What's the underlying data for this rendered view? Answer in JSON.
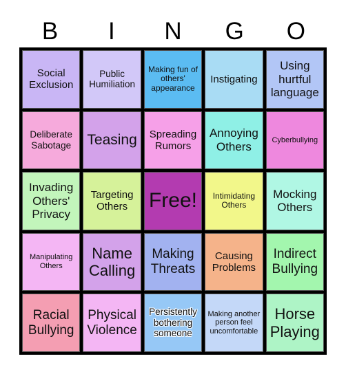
{
  "header": [
    "B",
    "I",
    "N",
    "G",
    "O"
  ],
  "cells": [
    {
      "text": "Social Exclusion",
      "color": "#c9b6f5"
    },
    {
      "text": "Public Humiliation",
      "color": "#d2c8f8"
    },
    {
      "text": "Making fun of others' appearance",
      "color": "#5bbcf2"
    },
    {
      "text": "Instigating",
      "color": "#a9dcf4"
    },
    {
      "text": "Using hurtful language",
      "color": "#b2c6f6"
    },
    {
      "text": "Deliberate Sabotage",
      "color": "#f6aadc"
    },
    {
      "text": "Teasing",
      "color": "#d3a2ea"
    },
    {
      "text": "Spreading Rumors",
      "color": "#f6a0e8"
    },
    {
      "text": "Annoying Others",
      "color": "#8ff0e6"
    },
    {
      "text": "Cyberbullying",
      "color": "#ee88de"
    },
    {
      "text": "Invading Others' Privacy",
      "color": "#c2f5bb"
    },
    {
      "text": "Targeting Others",
      "color": "#d6f29a"
    },
    {
      "text": "Free!",
      "color": "#b33bb0"
    },
    {
      "text": "Intimidating Others",
      "color": "#f2f78a"
    },
    {
      "text": "Mocking Others",
      "color": "#b0f7e4"
    },
    {
      "text": "Manipulating Others",
      "color": "#f4b6f4"
    },
    {
      "text": "Name Calling",
      "color": "#d3a2ea"
    },
    {
      "text": "Making Threats",
      "color": "#a2b2f0"
    },
    {
      "text": "Causing Problems",
      "color": "#f5b38a"
    },
    {
      "text": "Indirect Bullying",
      "color": "#a3f6ae"
    },
    {
      "text": "Racial Bullying",
      "color": "#f49eb2"
    },
    {
      "text": "Physical Violence",
      "color": "#f4b6f4"
    },
    {
      "text": "Persistently bothering someone",
      "color": "#96c8f6"
    },
    {
      "text": "Making another person feel uncomfortable",
      "color": "#c4d8f8"
    },
    {
      "text": "Horse Playing",
      "color": "#aef4c6"
    }
  ]
}
